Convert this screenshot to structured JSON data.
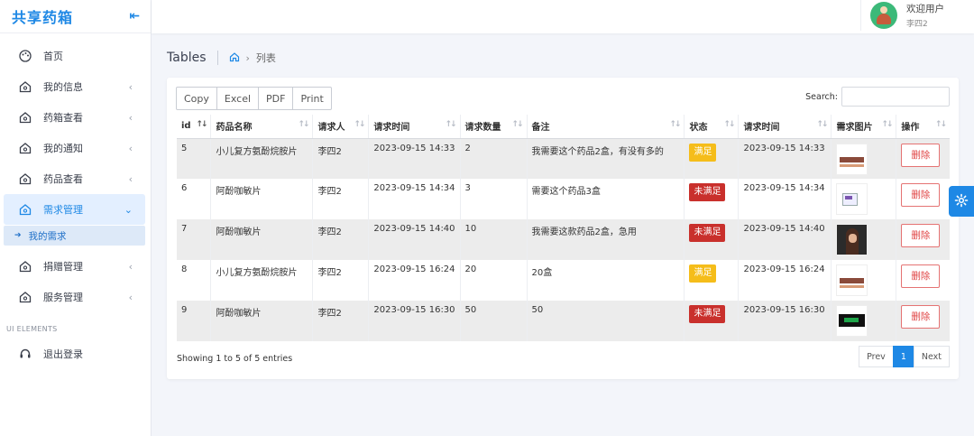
{
  "brand": {
    "title": "共享药箱"
  },
  "sidebar": {
    "items": [
      {
        "label": "首页",
        "icon": "palette-icon"
      },
      {
        "label": "我的信息",
        "icon": "home-icon"
      },
      {
        "label": "药箱查看",
        "icon": "home-icon"
      },
      {
        "label": "我的通知",
        "icon": "home-icon"
      },
      {
        "label": "药品查看",
        "icon": "home-icon"
      },
      {
        "label": "需求管理",
        "icon": "home-icon",
        "active": true
      },
      {
        "label": "捐赠管理",
        "icon": "home-icon"
      },
      {
        "label": "服务管理",
        "icon": "home-icon"
      }
    ],
    "sub_item": "我的需求",
    "section_label": "UI ELEMENTS",
    "logout": "退出登录"
  },
  "user": {
    "greeting": "欢迎用户",
    "name": "李四2"
  },
  "page": {
    "title": "Tables",
    "breadcrumb": "列表"
  },
  "toolbar": {
    "copy": "Copy",
    "excel": "Excel",
    "pdf": "PDF",
    "print": "Print"
  },
  "search": {
    "label": "Search:",
    "value": ""
  },
  "table": {
    "headers": [
      "id",
      "药品名称",
      "请求人",
      "请求时间",
      "请求数量",
      "备注",
      "状态",
      "请求时间",
      "需求图片",
      "操作"
    ],
    "rows": [
      {
        "id": "5",
        "name": "小儿复方氨酚烷胺片",
        "requester": "李四2",
        "time": "2023-09-15 14:33",
        "qty": "2",
        "note": "我需要这个药品2盒，有没有多的",
        "status": "满足",
        "status_color": "#f5bd1a",
        "time2": "2023-09-15 14:33",
        "action": "删除"
      },
      {
        "id": "6",
        "name": "阿酚咖敏片",
        "requester": "李四2",
        "time": "2023-09-15 14:34",
        "qty": "3",
        "note": "需要这个药品3盒",
        "status": "未满足",
        "status_color": "#c9302c",
        "time2": "2023-09-15 14:34",
        "action": "删除"
      },
      {
        "id": "7",
        "name": "阿酚咖敏片",
        "requester": "李四2",
        "time": "2023-09-15 14:40",
        "qty": "10",
        "note": "我需要这款药品2盒，急用",
        "status": "未满足",
        "status_color": "#c9302c",
        "time2": "2023-09-15 14:40",
        "action": "删除"
      },
      {
        "id": "8",
        "name": "小儿复方氨酚烷胺片",
        "requester": "李四2",
        "time": "2023-09-15 16:24",
        "qty": "20",
        "note": "20盒",
        "status": "满足",
        "status_color": "#f5bd1a",
        "time2": "2023-09-15 16:24",
        "action": "删除"
      },
      {
        "id": "9",
        "name": "阿酚咖敏片",
        "requester": "李四2",
        "time": "2023-09-15 16:30",
        "qty": "50",
        "note": "50",
        "status": "未满足",
        "status_color": "#c9302c",
        "time2": "2023-09-15 16:30",
        "action": "删除"
      }
    ]
  },
  "footer": {
    "info": "Showing 1 to 5 of 5 entries",
    "prev": "Prev",
    "page": "1",
    "next": "Next"
  },
  "colors": {
    "accent": "#1e88e5",
    "danger": "#e04545"
  }
}
